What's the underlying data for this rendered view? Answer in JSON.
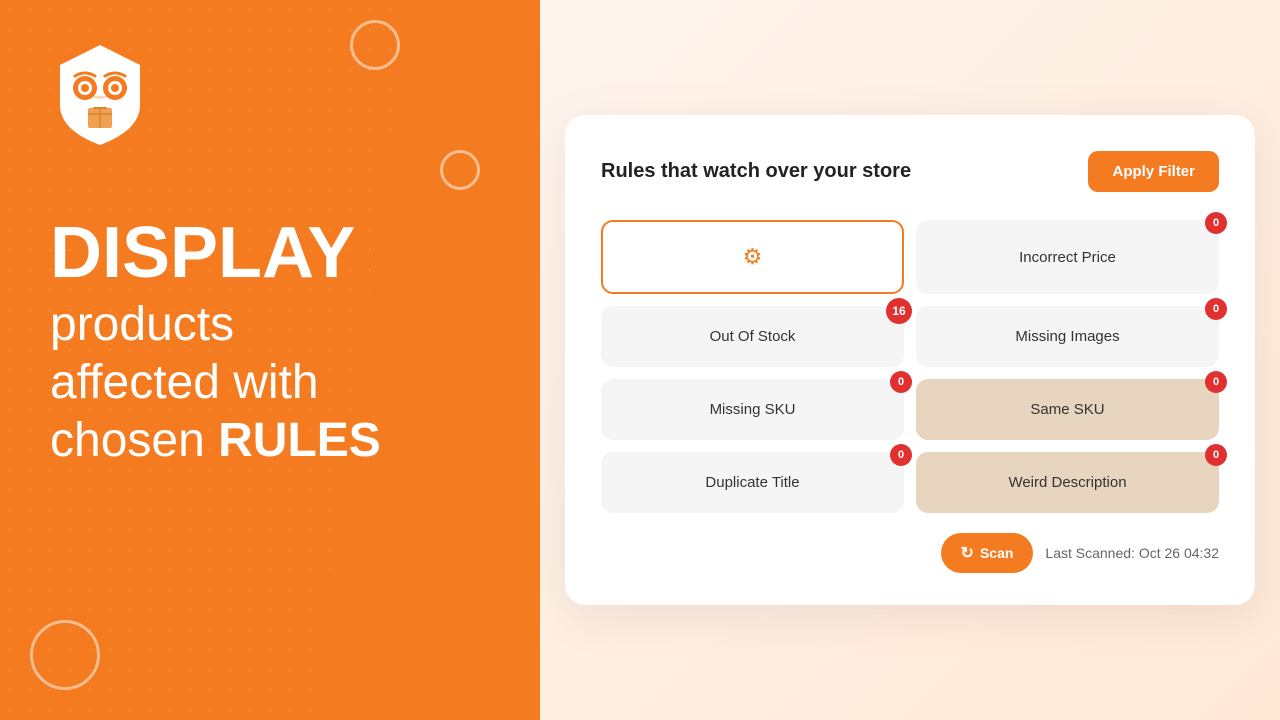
{
  "left": {
    "hero": {
      "line1": "DISPLAY",
      "line2": "products",
      "line3": "affected with",
      "line4_normal": "chosen ",
      "line4_bold": "RULES"
    }
  },
  "card": {
    "title": "Rules that watch over your store",
    "apply_filter_label": "Apply Filter",
    "rules": [
      {
        "id": "settings",
        "label": "",
        "icon": "gear",
        "badge": null,
        "active": true,
        "beige": false
      },
      {
        "id": "incorrect-price",
        "label": "Incorrect Price",
        "icon": null,
        "badge": "0",
        "active": false,
        "beige": false
      },
      {
        "id": "out-of-stock",
        "label": "Out Of Stock",
        "icon": null,
        "badge": "16",
        "active": false,
        "beige": false
      },
      {
        "id": "missing-images",
        "label": "Missing Images",
        "icon": null,
        "badge": "0",
        "active": false,
        "beige": false
      },
      {
        "id": "missing-sku",
        "label": "Missing SKU",
        "icon": null,
        "badge": "0",
        "active": false,
        "beige": false
      },
      {
        "id": "same-sku",
        "label": "Same SKU",
        "icon": null,
        "badge": "0",
        "active": false,
        "beige": true
      },
      {
        "id": "duplicate-title",
        "label": "Duplicate Title",
        "icon": null,
        "badge": "0",
        "active": false,
        "beige": false
      },
      {
        "id": "weird-description",
        "label": "Weird Description",
        "icon": null,
        "badge": "0",
        "active": false,
        "beige": true
      }
    ],
    "scan_label": "Scan",
    "last_scanned_label": "Last Scanned: Oct 26 04:32"
  }
}
